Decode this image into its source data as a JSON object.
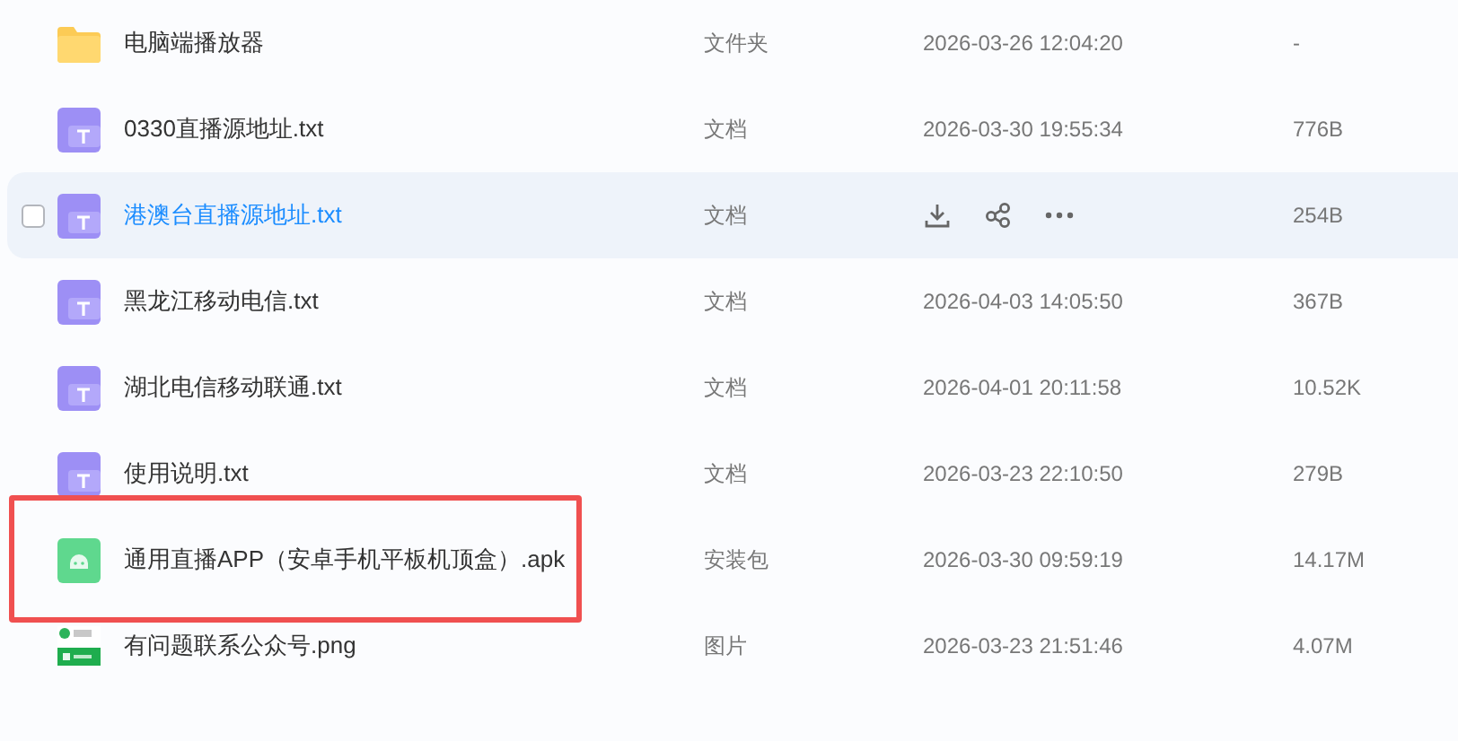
{
  "files": [
    {
      "kind": "folder",
      "name": "电脑端播放器",
      "type": "文件夹",
      "modified": "2026-03-26 12:04:20",
      "size": "-",
      "hovered": false,
      "highlighted": false
    },
    {
      "kind": "text",
      "name": "0330直播源地址.txt",
      "type": "文档",
      "modified": "2026-03-30 19:55:34",
      "size": "776B",
      "hovered": false,
      "highlighted": false
    },
    {
      "kind": "text",
      "name": "港澳台直播源地址.txt",
      "type": "文档",
      "size": "254B",
      "hovered": true,
      "checked": false,
      "highlighted": false
    },
    {
      "kind": "text",
      "name": "黑龙江移动电信.txt",
      "type": "文档",
      "modified": "2026-04-03 14:05:50",
      "size": "367B",
      "hovered": false,
      "highlighted": false
    },
    {
      "kind": "text",
      "name": "湖北电信移动联通.txt",
      "type": "文档",
      "modified": "2026-04-01 20:11:58",
      "size": "10.52K",
      "hovered": false,
      "highlighted": false
    },
    {
      "kind": "text",
      "name": "使用说明.txt",
      "type": "文档",
      "modified": "2026-03-23 22:10:50",
      "size": "279B",
      "hovered": false,
      "highlighted": false
    },
    {
      "kind": "package",
      "name": "通用直播APP（安卓手机平板机顶盒）.apk",
      "type": "安装包",
      "modified": "2026-03-30 09:59:19",
      "size": "14.17M",
      "hovered": false,
      "highlighted": true
    },
    {
      "name": "有问题联系公众号.png",
      "type": "图片",
      "modified": "2026-03-23 21:51:46",
      "size": "4.07M",
      "hovered": false,
      "highlighted": false
    }
  ]
}
